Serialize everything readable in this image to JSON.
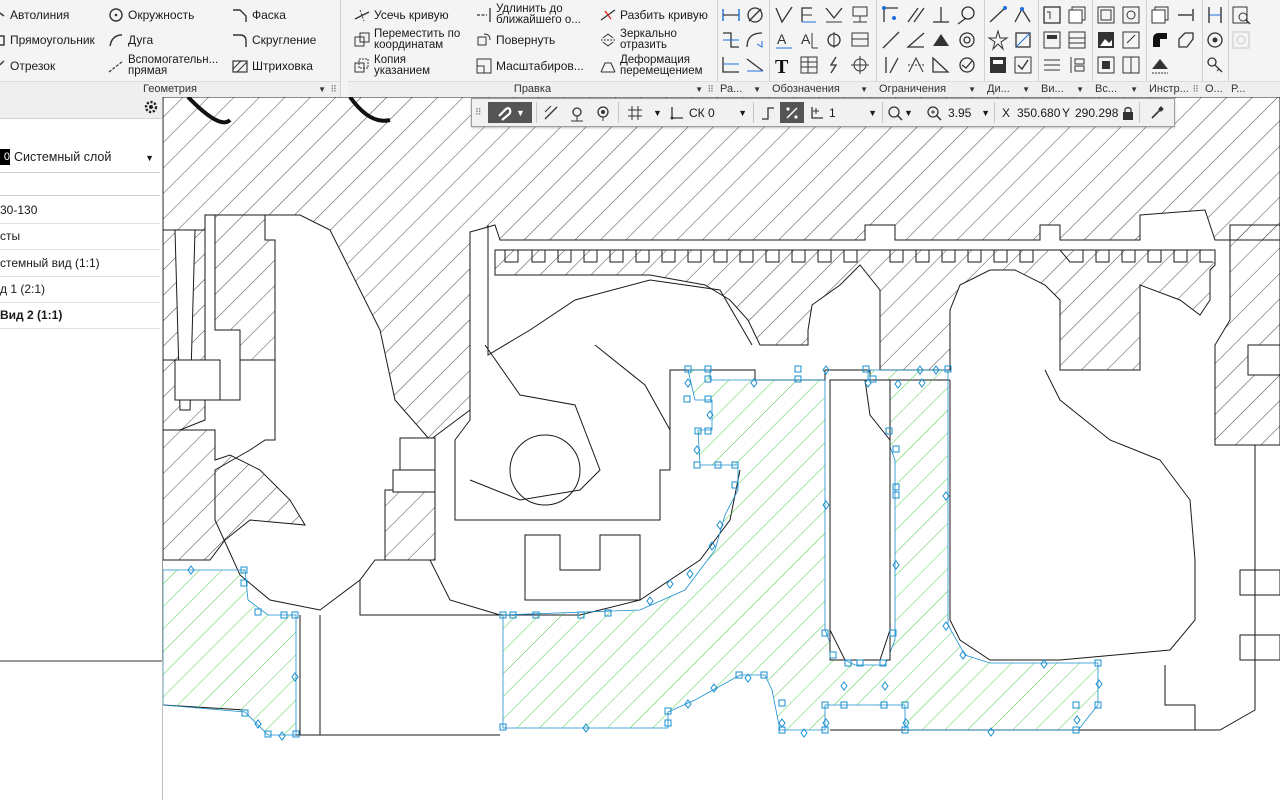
{
  "ribbon": {
    "geometry": {
      "title": "Геометрия",
      "items": [
        {
          "label": "Автолиния",
          "icon": "autoline-icon"
        },
        {
          "label": "Окружность",
          "icon": "circle-icon"
        },
        {
          "label": "Фаска",
          "icon": "chamfer-icon"
        },
        {
          "label": "Прямоугольник",
          "icon": "rectangle-icon"
        },
        {
          "label": "Дуга",
          "icon": "arc-icon"
        },
        {
          "label": "Скругление",
          "icon": "fillet-icon"
        },
        {
          "label": "Отрезок",
          "icon": "segment-icon"
        },
        {
          "label": "Вспомогательн... прямая",
          "line1": "Вспомогательн...",
          "line2": "прямая",
          "icon": "auxiliary-line-icon"
        },
        {
          "label": "Штриховка",
          "icon": "hatch-icon"
        }
      ]
    },
    "edit": {
      "title": "Правка",
      "items": [
        {
          "label": "Усечь кривую",
          "icon": "trim-curve-icon"
        },
        {
          "label": "Удлинить до ближайшего о...",
          "line1": "Удлинить до",
          "line2": "ближайшего о...",
          "icon": "extend-icon"
        },
        {
          "label": "Разбить кривую",
          "icon": "split-curve-icon"
        },
        {
          "label": "Переместить по координатам",
          "line1": "Переместить по",
          "line2": "координатам",
          "icon": "move-coordinates-icon"
        },
        {
          "label": "Повернуть",
          "icon": "rotate-icon"
        },
        {
          "label": "Зеркально отразить",
          "line1": "Зеркально",
          "line2": "отразить",
          "icon": "mirror-icon"
        },
        {
          "label": "Копия указанием",
          "line1": "Копия",
          "line2": "указанием",
          "icon": "copy-icon"
        },
        {
          "label": "Масштабиров...",
          "icon": "scale-icon"
        },
        {
          "label": "Деформация перемещением",
          "line1": "Деформация",
          "line2": "перемещением",
          "icon": "deform-icon"
        }
      ]
    },
    "small_groups": [
      {
        "title": "Ра...",
        "name": "group-ra"
      },
      {
        "title": "Обозначения",
        "name": "group-designations"
      },
      {
        "title": "Ограничения",
        "name": "group-constraints"
      },
      {
        "title": "Ди...",
        "name": "group-di"
      },
      {
        "title": "Ви...",
        "name": "group-vi"
      },
      {
        "title": "Вс...",
        "name": "group-vs"
      },
      {
        "title": "Инстр...",
        "name": "group-tools"
      },
      {
        "title": "О...",
        "name": "group-o"
      },
      {
        "title": "Р...",
        "name": "group-r"
      }
    ]
  },
  "panel": {
    "layer_number": "0",
    "layer_name": "Системный слой",
    "tree": [
      {
        "label": "30-130",
        "bold": false
      },
      {
        "label": "сты",
        "bold": false
      },
      {
        "label": "стемный вид (1:1)",
        "bold": false
      },
      {
        "label": "д 1 (2:1)",
        "bold": false
      },
      {
        "label": "Вид 2 (1:1)",
        "bold": true
      }
    ]
  },
  "float_toolbar": {
    "cs_label": "СК 0",
    "step_value": "1",
    "zoom_value": "3.95",
    "x_label": "X",
    "x_value": "350.680",
    "y_label": "Y",
    "y_value": "290.298"
  },
  "colors": {
    "ribbon_bg": "#f4f4f4",
    "icon_blue": "#1e6fd9",
    "selection_green": "#3ec73e",
    "marker_blue": "#1a8fd0"
  }
}
